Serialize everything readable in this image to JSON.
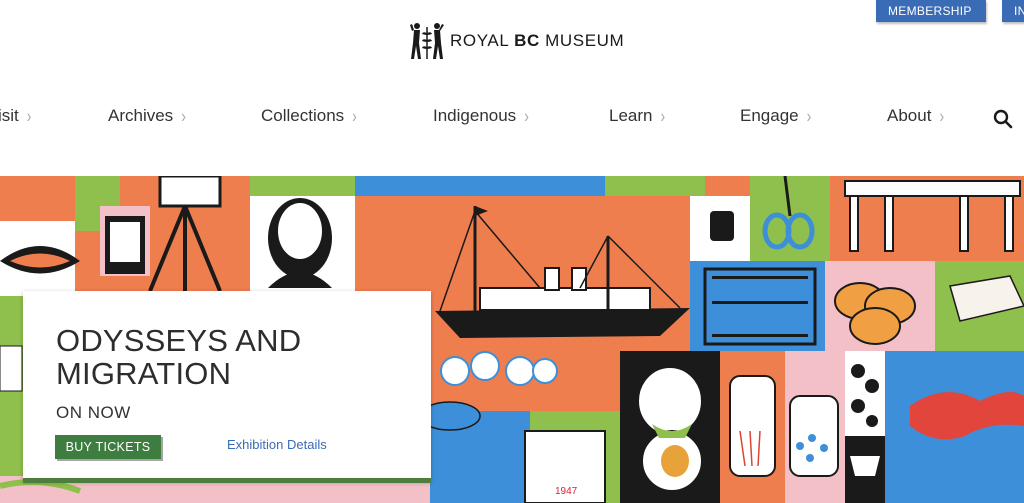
{
  "utility": {
    "membership_label": "MEMBERSHIP",
    "partial_label": "IN"
  },
  "logo": {
    "text_royal": "ROYAL ",
    "text_bc": "BC",
    "text_museum": " MUSEUM",
    "icon": "figures-logo-icon"
  },
  "nav": {
    "items": [
      {
        "label": "isit"
      },
      {
        "label": "Archives"
      },
      {
        "label": "Collections"
      },
      {
        "label": "Indigenous"
      },
      {
        "label": "Learn"
      },
      {
        "label": "Engage"
      },
      {
        "label": "About"
      }
    ],
    "chevron": "›",
    "search_icon": "search-icon"
  },
  "hero": {
    "title": "ODYSSEYS AND MIGRATION",
    "subtitle": "ON NOW",
    "buy_label": "BUY TICKETS",
    "details_label": "Exhibition Details",
    "stamp_year": "1947",
    "colors": {
      "orange": "#ef7e4f",
      "green": "#8fbf4d",
      "blue": "#3c8fd8",
      "pink": "#f4c0c8",
      "buy_button": "#3d7d3f",
      "link": "#3a6bb5"
    }
  }
}
